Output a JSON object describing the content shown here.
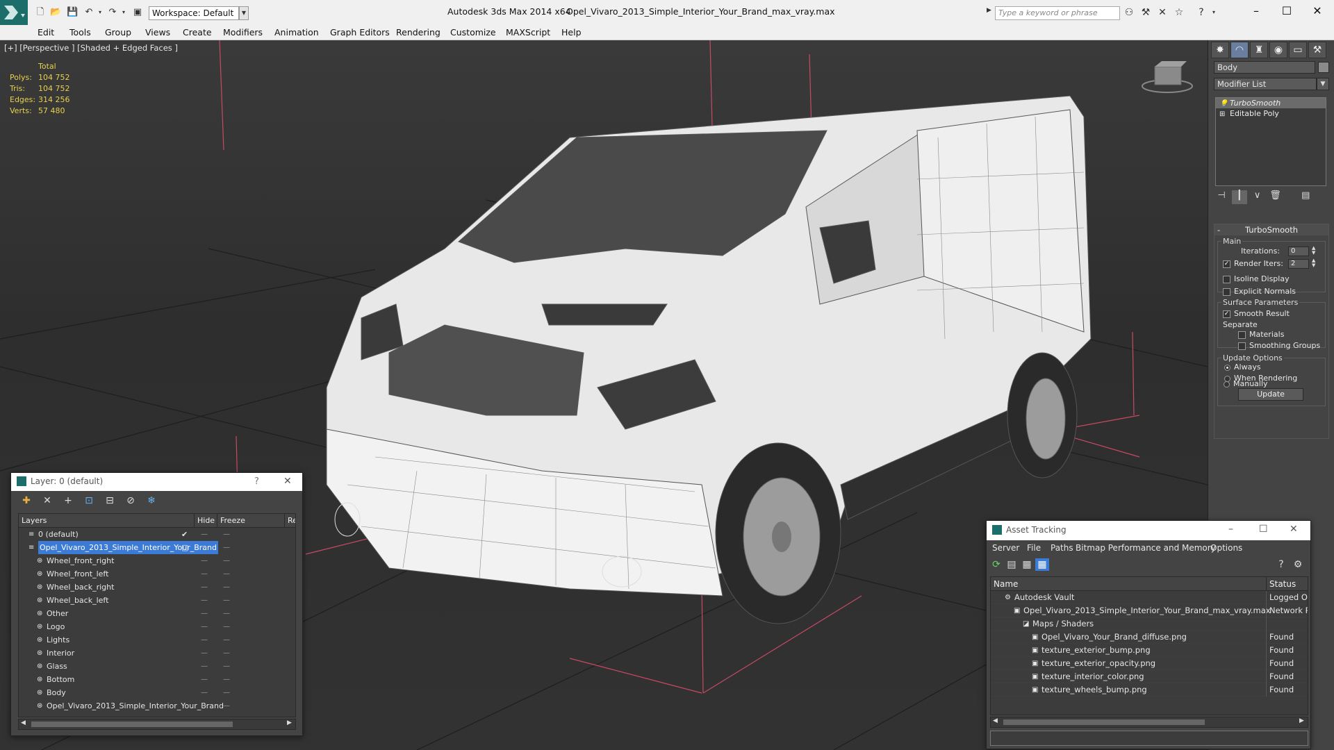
{
  "titlebar": {
    "workspace": "Workspace: Default",
    "app_title": "Autodesk 3ds Max  2014 x64",
    "file_title": "Opel_Vivaro_2013_Simple_Interior_Your_Brand_max_vray.max",
    "search_placeholder": "Type a keyword or phrase"
  },
  "menu": [
    "Edit",
    "Tools",
    "Group",
    "Views",
    "Create",
    "Modifiers",
    "Animation",
    "Graph Editors",
    "Rendering",
    "Customize",
    "MAXScript",
    "Help"
  ],
  "viewport": {
    "label": "[+] [Perspective ] [Shaded + Edged Faces ]",
    "stats_header": "Total",
    "stats": [
      {
        "key": "Polys:",
        "value": "104 752"
      },
      {
        "key": "Tris:",
        "value": "104 752"
      },
      {
        "key": "Edges:",
        "value": "314 256"
      },
      {
        "key": "Verts:",
        "value": "57 480"
      }
    ]
  },
  "command_panel": {
    "object_name": "Body",
    "modifier_list": "Modifier List",
    "stack": [
      {
        "label": "TurboSmooth",
        "selected": true
      },
      {
        "label": "Editable Poly",
        "selected": false
      }
    ],
    "turbosmooth": {
      "title": "TurboSmooth",
      "main_label": "Main",
      "iterations_label": "Iterations:",
      "iterations_value": "0",
      "render_iters_label": "Render Iters:",
      "render_iters_value": "2",
      "render_iters_checked": true,
      "isoline_label": "Isoline Display",
      "explicit_normals_label": "Explicit Normals",
      "surface_params_label": "Surface Parameters",
      "smooth_result_label": "Smooth Result",
      "separate_label": "Separate",
      "materials_label": "Materials",
      "smoothing_groups_label": "Smoothing Groups",
      "update_options_label": "Update Options",
      "always_label": "Always",
      "when_rendering_label": "When Rendering",
      "manually_label": "Manually",
      "update_button": "Update"
    }
  },
  "layer_window": {
    "title": "Layer: 0 (default)",
    "help": "?",
    "columns": {
      "layers": "Layers",
      "hide": "Hide",
      "freeze": "Freeze",
      "render": "Re"
    },
    "rows": [
      {
        "name": "0 (default)",
        "indent": 1,
        "active": true,
        "selected": false
      },
      {
        "name": "Opel_Vivaro_2013_Simple_Interior_Your_Brand",
        "indent": 1,
        "active": false,
        "selected": true
      },
      {
        "name": "Wheel_front_right",
        "indent": 2,
        "active": false,
        "selected": false
      },
      {
        "name": "Wheel_front_left",
        "indent": 2,
        "active": false,
        "selected": false
      },
      {
        "name": "Wheel_back_right",
        "indent": 2,
        "active": false,
        "selected": false
      },
      {
        "name": "Wheel_back_left",
        "indent": 2,
        "active": false,
        "selected": false
      },
      {
        "name": "Other",
        "indent": 2,
        "active": false,
        "selected": false
      },
      {
        "name": "Logo",
        "indent": 2,
        "active": false,
        "selected": false
      },
      {
        "name": "Lights",
        "indent": 2,
        "active": false,
        "selected": false
      },
      {
        "name": "Interior",
        "indent": 2,
        "active": false,
        "selected": false
      },
      {
        "name": "Glass",
        "indent": 2,
        "active": false,
        "selected": false
      },
      {
        "name": "Bottom",
        "indent": 2,
        "active": false,
        "selected": false
      },
      {
        "name": "Body",
        "indent": 2,
        "active": false,
        "selected": false
      },
      {
        "name": "Opel_Vivaro_2013_Simple_Interior_Your_Brand",
        "indent": 2,
        "active": false,
        "selected": false
      }
    ]
  },
  "asset_window": {
    "title": "Asset Tracking",
    "menu": [
      "Server",
      "File",
      "Paths",
      "Bitmap Performance and Memory",
      "Options"
    ],
    "columns": {
      "name": "Name",
      "status": "Status"
    },
    "rows": [
      {
        "name": "Autodesk Vault",
        "status": "Logged Ou",
        "indent": 1,
        "icon": "vault-icon"
      },
      {
        "name": "Opel_Vivaro_2013_Simple_Interior_Your_Brand_max_vray.max",
        "status": "Network Pa",
        "indent": 2,
        "icon": "max-file-icon"
      },
      {
        "name": "Maps / Shaders",
        "status": "",
        "indent": 3,
        "icon": "maps-icon"
      },
      {
        "name": "Opel_Vivaro_Your_Brand_diffuse.png",
        "status": "Found",
        "indent": 4,
        "icon": "bitmap-icon"
      },
      {
        "name": "texture_exterior_bump.png",
        "status": "Found",
        "indent": 4,
        "icon": "bitmap-icon"
      },
      {
        "name": "texture_exterior_opacity.png",
        "status": "Found",
        "indent": 4,
        "icon": "bitmap-icon"
      },
      {
        "name": "texture_interior_color.png",
        "status": "Found",
        "indent": 4,
        "icon": "bitmap-icon"
      },
      {
        "name": "texture_wheels_bump.png",
        "status": "Found",
        "indent": 4,
        "icon": "bitmap-icon"
      }
    ]
  },
  "colors": {
    "stats": "#e8d24a",
    "selection": "#3b7bd6",
    "viewport_bg": "#333333",
    "gizmo_pink": "#d0506a"
  }
}
